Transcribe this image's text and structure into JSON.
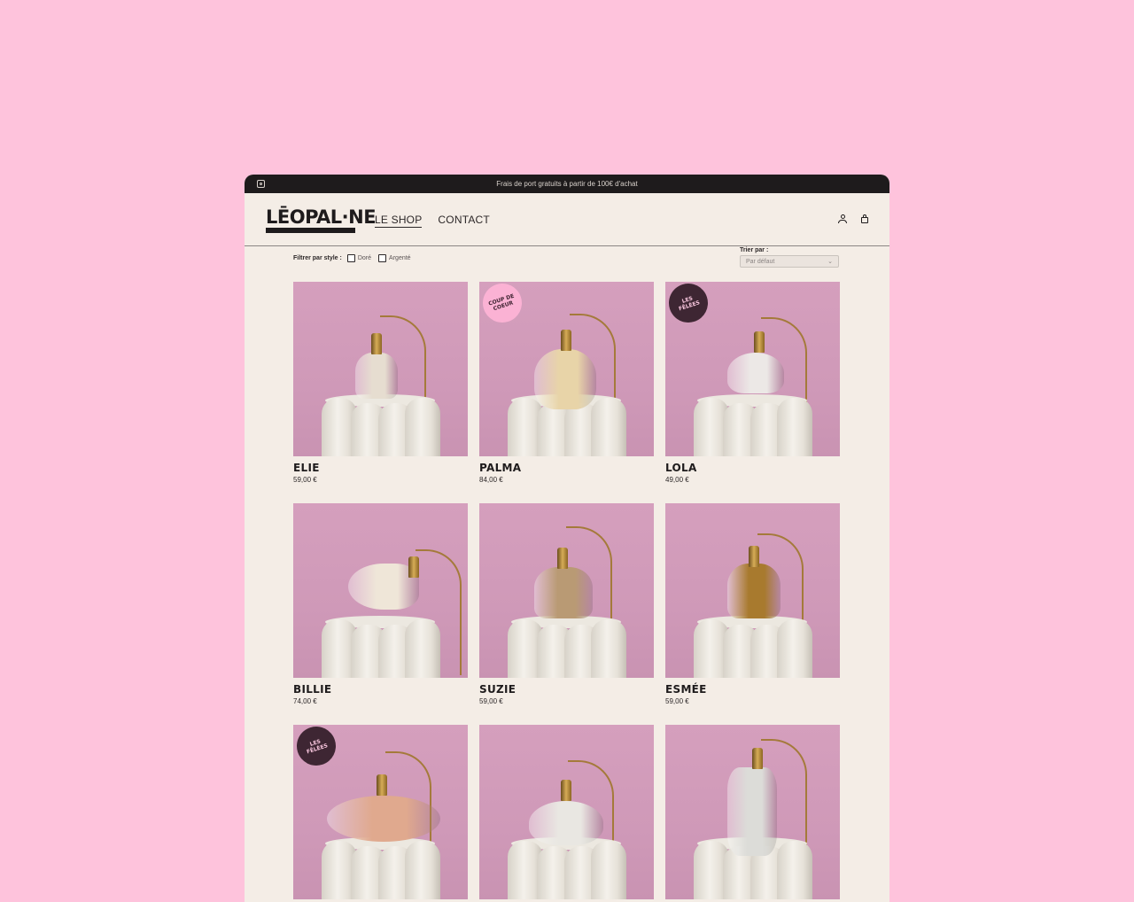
{
  "announcement": "Frais de port gratuits à partir de 100€ d'achat",
  "brand": {
    "logo_text": "LĒOPAL·NE"
  },
  "nav": [
    {
      "label": "LE SHOP",
      "active": true
    },
    {
      "label": "CONTACT",
      "active": false
    }
  ],
  "filters": {
    "label": "Filtrer par style :",
    "options": [
      {
        "label": "Doré",
        "checked": false
      },
      {
        "label": "Argenté",
        "checked": false
      }
    ]
  },
  "sort": {
    "label": "Trier par :",
    "selected": "Par défaut"
  },
  "products": [
    {
      "name": "ELIE",
      "price": "59,00 €",
      "badge": "",
      "shade_color": "#e6ddd0"
    },
    {
      "name": "PALMA",
      "price": "84,00 €",
      "badge": "COUP DE COEUR",
      "badge_style": "pink",
      "shade_color": "#e8d4a8"
    },
    {
      "name": "LOLA",
      "price": "49,00 €",
      "badge": "LES FÊLÉES",
      "badge_style": "dark",
      "shade_color": "#ece8e6"
    },
    {
      "name": "BILLIE",
      "price": "74,00 €",
      "badge": "",
      "shade_color": "#efe6d8"
    },
    {
      "name": "SUZIE",
      "price": "59,00 €",
      "badge": "",
      "shade_color": "#b99a74"
    },
    {
      "name": "ESMÉE",
      "price": "59,00 €",
      "badge": "",
      "shade_color": "#a87a2e"
    },
    {
      "name": "",
      "price": "",
      "badge": "LES FÊLÉES",
      "badge_style": "dark",
      "shade_color": "#e0a98e"
    },
    {
      "name": "",
      "price": "",
      "badge": "",
      "shade_color": "#e9e7e2"
    },
    {
      "name": "",
      "price": "",
      "badge": "",
      "shade_color": "#dcdcd8"
    }
  ],
  "icons": {
    "instagram": "instagram-icon",
    "account": "user-icon",
    "cart": "bag-icon"
  }
}
